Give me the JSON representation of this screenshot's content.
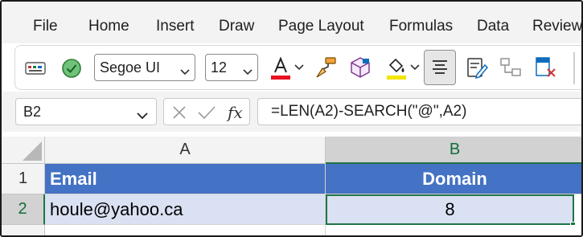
{
  "menu": {
    "items": [
      "File",
      "Home",
      "Insert",
      "Draw",
      "Page Layout",
      "Formulas",
      "Data",
      "Review"
    ]
  },
  "toolbar": {
    "font_name": "Segoe UI",
    "font_size": "12",
    "font_color": "#e81123",
    "fill_color": "#f2e600",
    "icons": [
      "keyboard-icon",
      "check-circle-icon",
      "font-color-icon",
      "format-painter-icon",
      "cube-icon",
      "fill-bucket-icon",
      "align-center-icon",
      "form-edit-icon",
      "link-transform-icon",
      "delete-sheet-icon"
    ]
  },
  "formula_bar": {
    "name_box": "B2",
    "formula": "=LEN(A2)-SEARCH(\"@\",A2)"
  },
  "sheet": {
    "columns": [
      "A",
      "B"
    ],
    "rows": [
      "1",
      "2"
    ],
    "cells": {
      "A1": "Email",
      "B1": "Domain",
      "A2": "houle@yahoo.ca",
      "B2": "8"
    },
    "header_fill": "#4472c4",
    "data_fill": "#d9e1f2",
    "accent": "#217346"
  }
}
